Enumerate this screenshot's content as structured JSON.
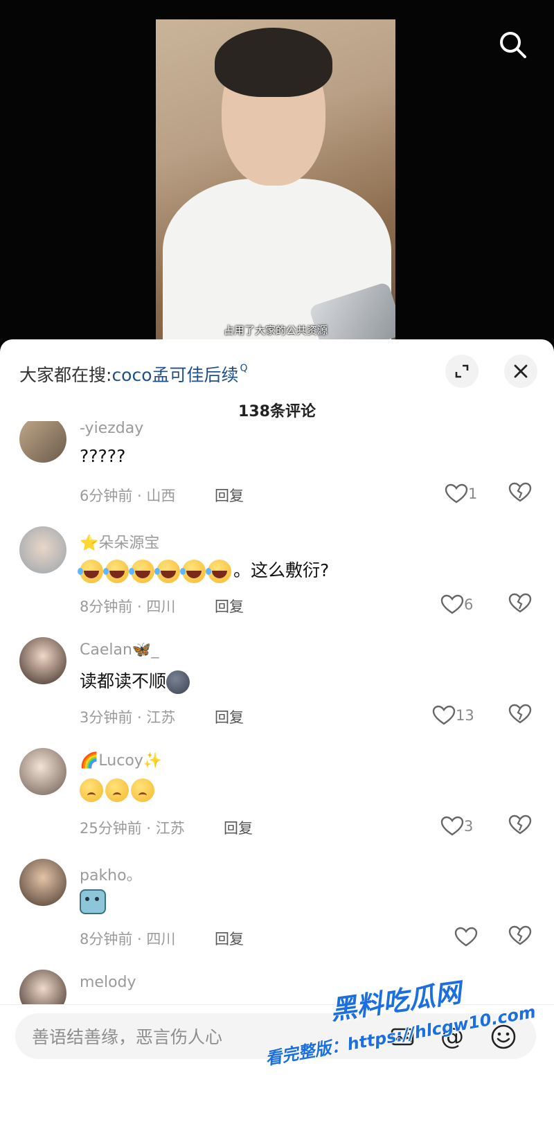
{
  "video": {
    "subtitle": "占用了大家的公共资源"
  },
  "hot_search": {
    "label": "大家都在搜:",
    "term": "coco孟可佳后续",
    "q_mark": "Q"
  },
  "comments_title": "138条评论",
  "comments": [
    {
      "username": "-yiezday",
      "content": "?????",
      "time": "6分钟前 · 山西",
      "reply": "回复",
      "likes": "1"
    },
    {
      "username": "朵朵源宝",
      "username_prefix": "⭐",
      "content": "。这么敷衍?",
      "time": "8分钟前 · 四川",
      "reply": "回复",
      "likes": "6"
    },
    {
      "username": "Caelan",
      "username_suffix": "_",
      "content": "读都读不顺",
      "time": "3分钟前 · 江苏",
      "reply": "回复",
      "likes": "13"
    },
    {
      "username": "Lucoy",
      "content": "",
      "time": "25分钟前 · 江苏",
      "reply": "回复",
      "likes": "3"
    },
    {
      "username": "pakho。",
      "content": "",
      "time": "8分钟前 · 四川",
      "reply": "回复",
      "likes": ""
    },
    {
      "username": "melody"
    }
  ],
  "input": {
    "placeholder": "善语结善缘，恶言伤人心",
    "at_symbol": "@"
  },
  "watermark": {
    "brand": "黑料吃瓜网",
    "url_text": "看完整版：https://hlcgw10.com"
  },
  "colors": {
    "link_blue": "#1e4f8a",
    "meta_gray": "#9a9a9a",
    "watermark_blue": "#1b6fe0"
  },
  "icons": {
    "top_search": "search-icon",
    "expand": "expand-icon",
    "close": "close-icon",
    "like": "heart-icon",
    "dislike": "broken-heart-icon",
    "image": "image-icon",
    "at": "at-icon",
    "emoji": "emoji-icon"
  }
}
